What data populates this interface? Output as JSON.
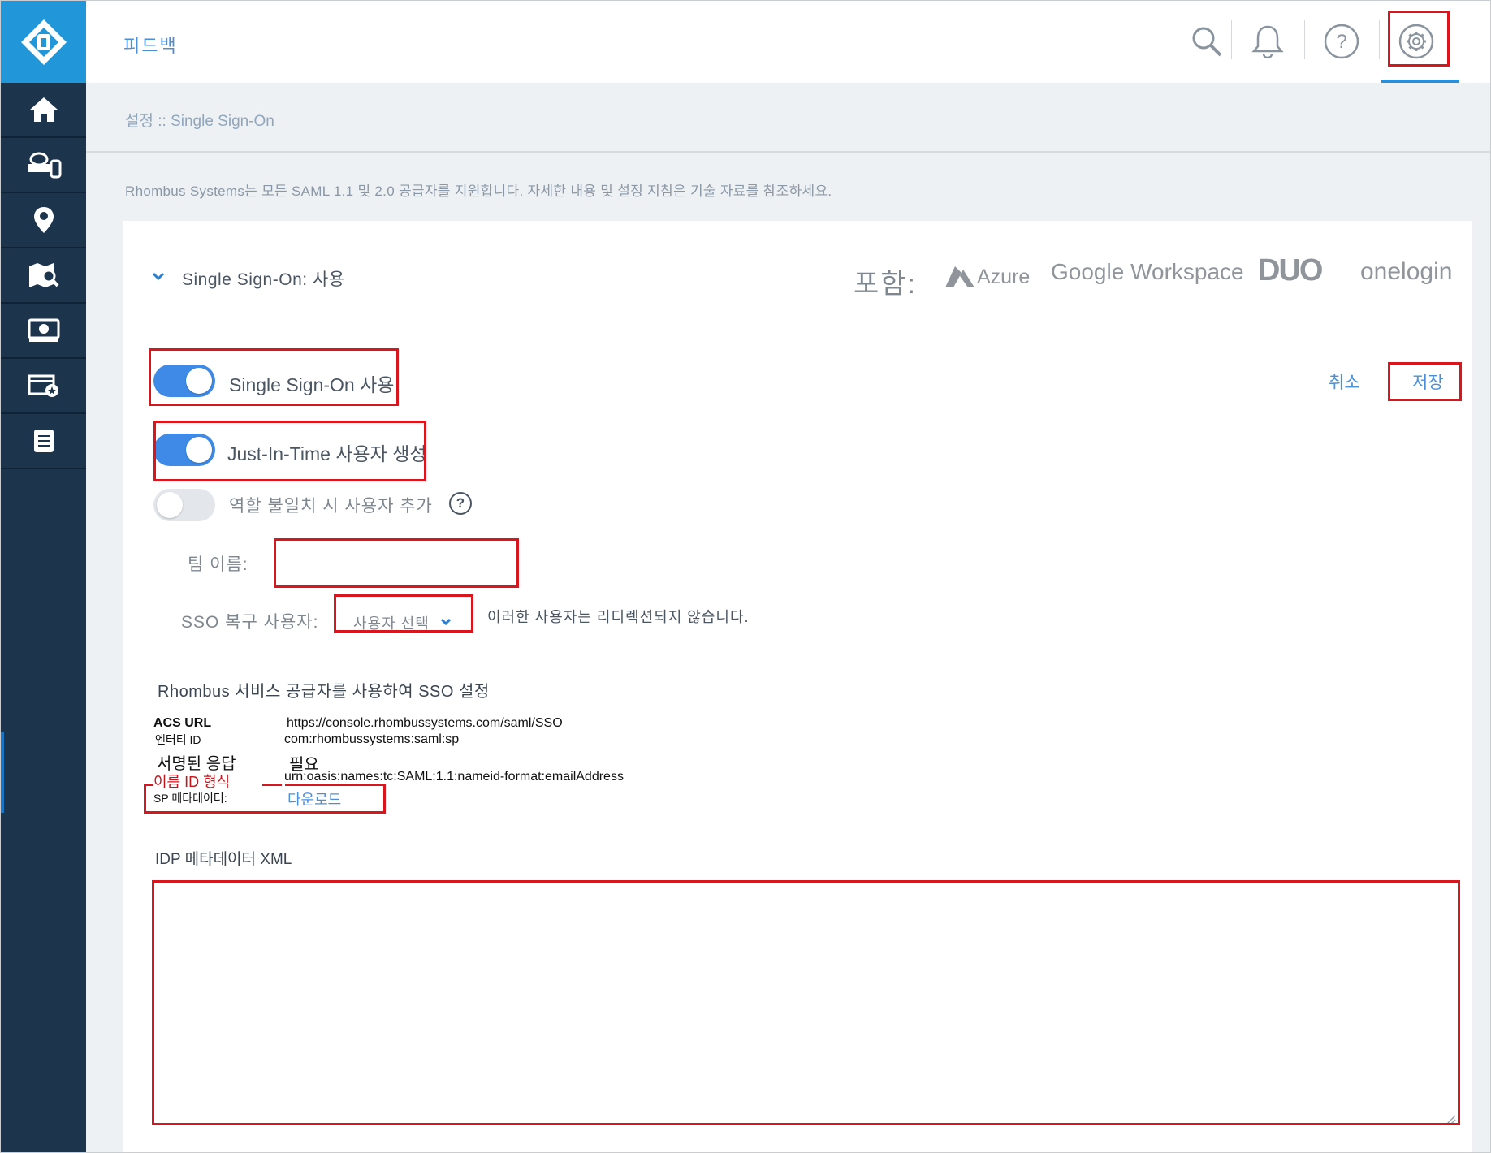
{
  "header": {
    "feedback_label": "피드백",
    "icons": [
      "search-icon",
      "bell-icon",
      "help-icon",
      "gear-icon"
    ]
  },
  "breadcrumb": "설정 :: Single Sign-On",
  "info_text": "Rhombus Systems는 모든 SAML 1.1 및 2.0 공급자를 지원합니다. 자세한 내용 및 설정 지침은 기술 자료를 참조하세요.",
  "sidebar": {
    "items": [
      "home-icon",
      "camera-devices-icon",
      "location-pin-icon",
      "map-search-icon",
      "video-player-icon",
      "film-star-icon",
      "document-icon"
    ]
  },
  "panel": {
    "title": "Single Sign-On: 사용",
    "includes_label": "포함:",
    "brands": [
      "Azure",
      "Google Workspace",
      "DUO",
      "onelogin"
    ]
  },
  "toggles": {
    "sso": {
      "label": "Single Sign-On 사용",
      "on": true
    },
    "jit": {
      "label": "Just-In-Time 사용자 생성",
      "on": true
    },
    "role_mismatch": {
      "label": "역할 불일치 시 사용자 추가",
      "on": false
    }
  },
  "actions": {
    "cancel": "취소",
    "save": "저장"
  },
  "team_name": {
    "label": "팀 이름:",
    "value": ""
  },
  "recovery_user": {
    "label": "SSO 복구 사용자:",
    "select_placeholder": "사용자 선택",
    "note": "이러한 사용자는 리디렉션되지 않습니다."
  },
  "sp_section": {
    "title": "Rhombus 서비스 공급자를 사용하여 SSO 설정",
    "acs_key": "ACS URL",
    "acs_val": "https://console.rhombussystems.com/saml/SSO",
    "entity_key": "엔터티 ID",
    "entity_val": "com:rhombussystems:saml:sp",
    "signed_key": "서명된 응답",
    "signed_val": "필요",
    "nameid_key": "이름 ID 형식",
    "nameid_val": "urn:oasis:names:tc:SAML:1.1:nameid-format:emailAddress",
    "metadata_key": "SP 메타데이터:",
    "metadata_link": "다운로드"
  },
  "idp_xml": {
    "label": "IDP 메타데이터 XML",
    "value": ""
  },
  "colors": {
    "sidebar": "#1d344d",
    "logo_bg": "#2196d8",
    "accent": "#3e8ae6",
    "highlight": "#d9151d"
  }
}
